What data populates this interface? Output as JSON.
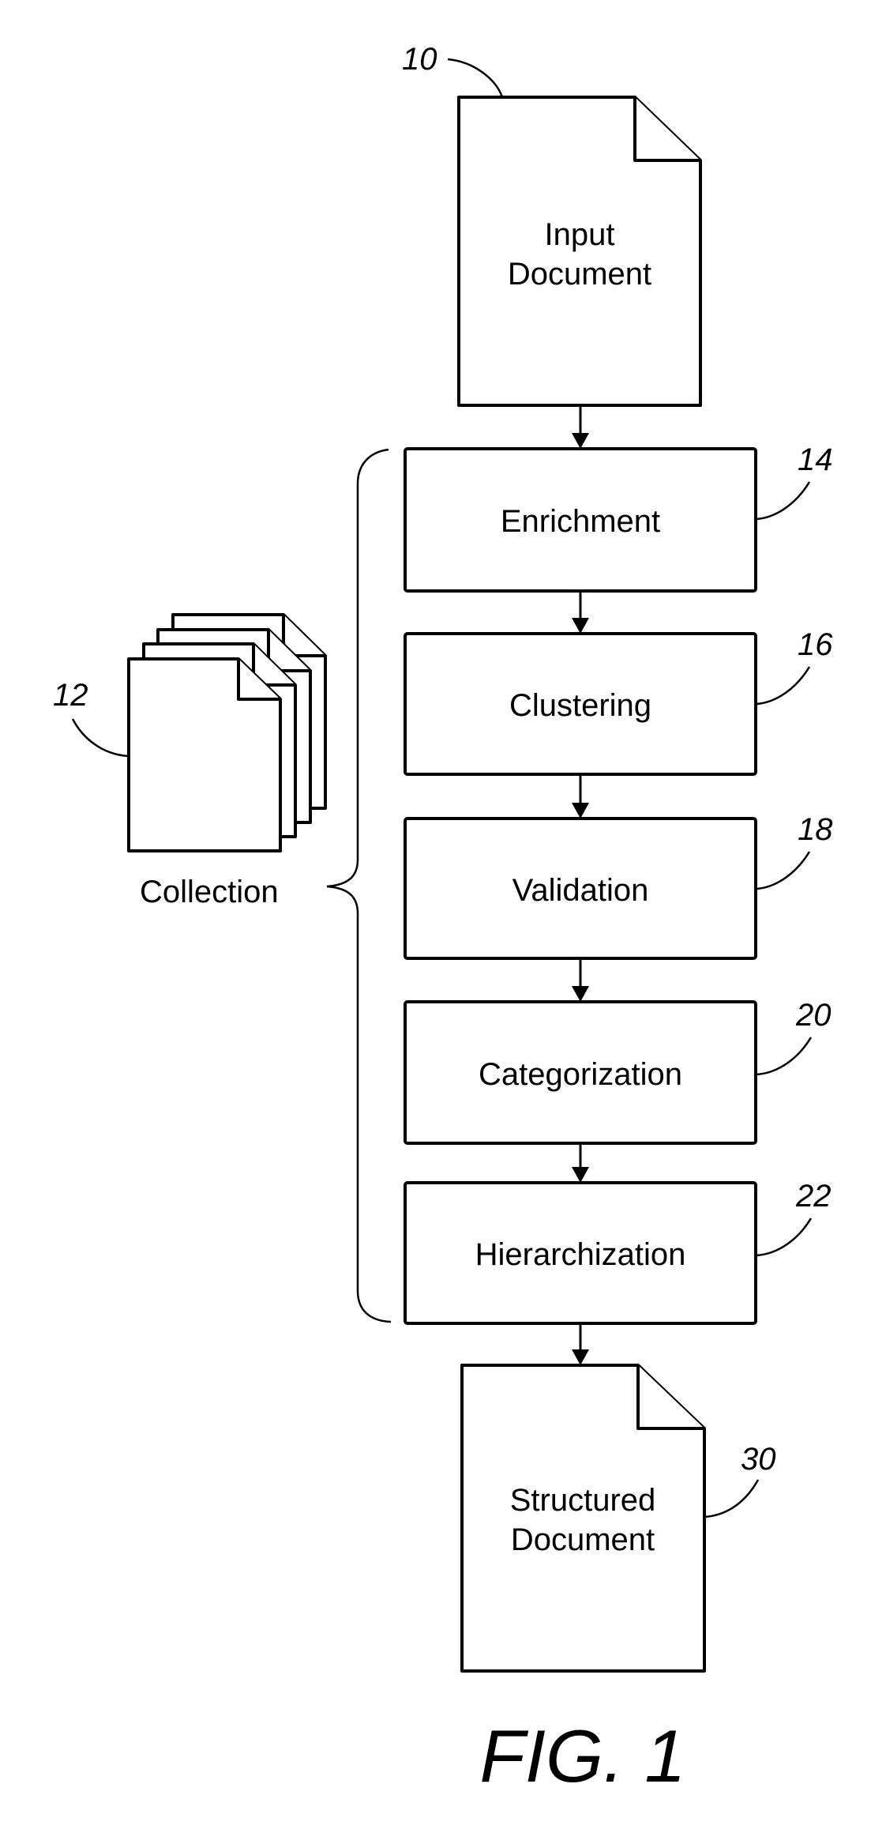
{
  "figure": {
    "caption": "FIG. 1",
    "input_document": {
      "ref": "10",
      "lines": [
        "Input",
        "Document"
      ]
    },
    "collection": {
      "ref": "12",
      "label": "Collection",
      "sheet_count": 4
    },
    "steps": [
      {
        "ref": "14",
        "label": "Enrichment"
      },
      {
        "ref": "16",
        "label": "Clustering"
      },
      {
        "ref": "18",
        "label": "Validation"
      },
      {
        "ref": "20",
        "label": "Categorization"
      },
      {
        "ref": "22",
        "label": "Hierarchization"
      }
    ],
    "output_document": {
      "ref": "30",
      "lines": [
        "Structured",
        "Document"
      ]
    }
  }
}
